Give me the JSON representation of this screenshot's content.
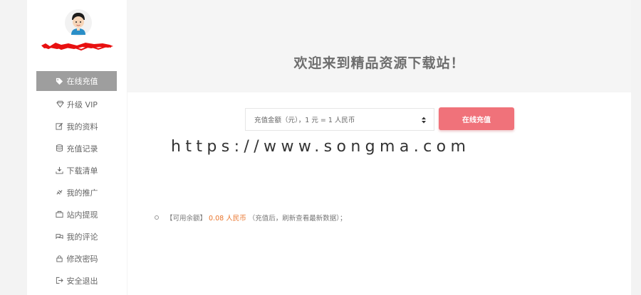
{
  "sidebar": {
    "items": [
      {
        "label": "在线充值",
        "icon": "tag-icon"
      },
      {
        "label": "升级 VIP",
        "icon": "diamond-icon"
      },
      {
        "label": "我的资料",
        "icon": "edit-icon"
      },
      {
        "label": "充值记录",
        "icon": "database-icon"
      },
      {
        "label": "下载清单",
        "icon": "download-icon"
      },
      {
        "label": "我的推广",
        "icon": "share-icon"
      },
      {
        "label": "站内提现",
        "icon": "wallet-icon"
      },
      {
        "label": "我的评论",
        "icon": "comments-icon"
      },
      {
        "label": "修改密码",
        "icon": "lock-icon"
      },
      {
        "label": "安全退出",
        "icon": "sign-out-icon"
      }
    ]
  },
  "banner": {
    "title": "欢迎来到精品资源下载站！"
  },
  "recharge": {
    "select_value": "充值金额（元），1 元 = 1 人民币",
    "button_label": "在线充值"
  },
  "watermark": "https://www.songma.com",
  "balance": {
    "prefix": "【可用余额】",
    "value": "0.08 人民币",
    "suffix": "（充值后，刷新查看最新数据）；"
  },
  "colors": {
    "accent": "#f0727a",
    "balance_value": "#e9742b",
    "sidebar_active": "#9e9e9e"
  }
}
